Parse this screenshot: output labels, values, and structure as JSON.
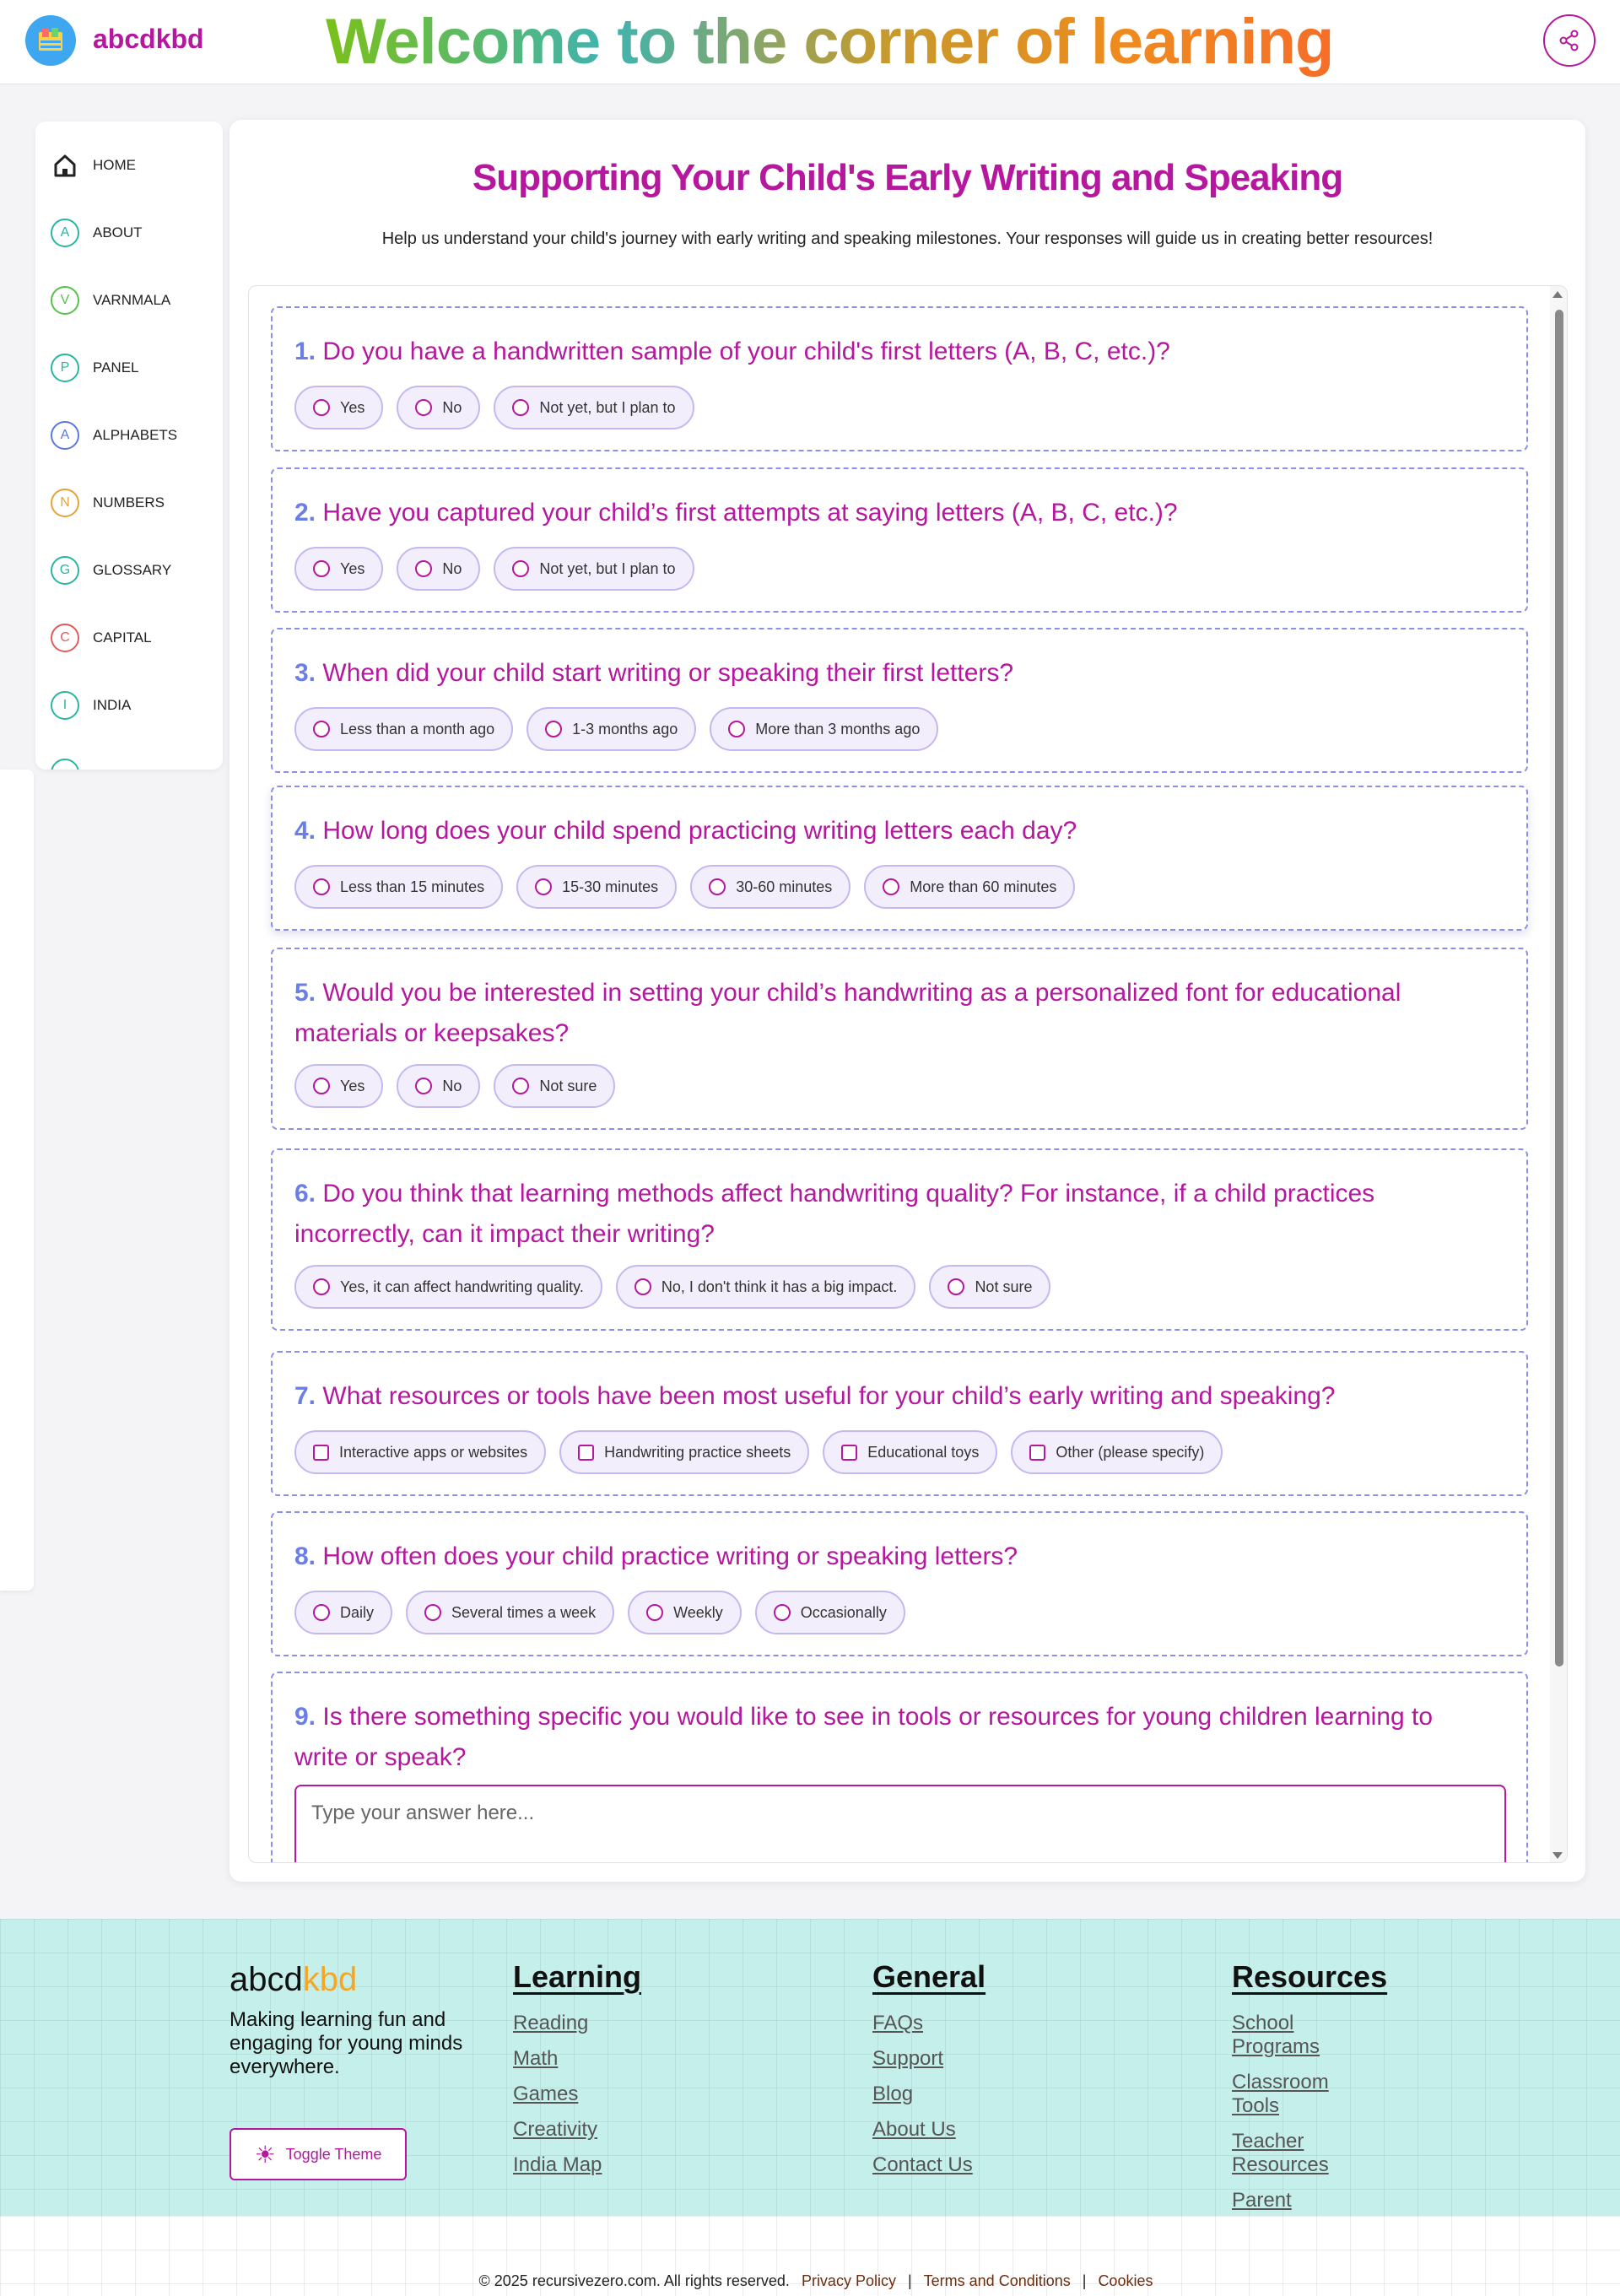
{
  "header": {
    "brand": "abcdkbd",
    "welcome": "Welcome to the corner of learning"
  },
  "sidebar": {
    "items": [
      {
        "label": "HOME",
        "icon": "home-icon",
        "letter": "",
        "color": "#222222"
      },
      {
        "label": "ABOUT",
        "icon": "letter-a-icon",
        "letter": "A",
        "color": "#2bb5a0"
      },
      {
        "label": "VARNMALA",
        "icon": "letter-v-icon",
        "letter": "V",
        "color": "#55c24a"
      },
      {
        "label": "PANEL",
        "icon": "letter-p-icon",
        "letter": "P",
        "color": "#2bb5a0"
      },
      {
        "label": "ALPHABETS",
        "icon": "letter-a-icon",
        "letter": "A",
        "color": "#5d77e0"
      },
      {
        "label": "NUMBERS",
        "icon": "letter-n-icon",
        "letter": "N",
        "color": "#e6a23a"
      },
      {
        "label": "GLOSSARY",
        "icon": "letter-g-icon",
        "letter": "G",
        "color": "#2bb5a0"
      },
      {
        "label": "CAPITAL",
        "icon": "letter-c-icon",
        "letter": "C",
        "color": "#e25b5b"
      },
      {
        "label": "INDIA",
        "icon": "letter-i-icon",
        "letter": "I",
        "color": "#2bb5a0"
      }
    ]
  },
  "main": {
    "title": "Supporting Your Child's Early Writing and Speaking",
    "subtitle": "Help us understand your child's journey with early writing and speaking milestones. Your responses will guide us in creating better resources!"
  },
  "questions": [
    {
      "num": "1.",
      "text": "Do you have a handwritten sample of your child's first letters (A, B, C, etc.)?",
      "type": "radio",
      "options": [
        "Yes",
        "No",
        "Not yet, but I plan to"
      ]
    },
    {
      "num": "2.",
      "text": "Have you captured your child’s first attempts at saying letters (A, B, C, etc.)?",
      "type": "radio",
      "options": [
        "Yes",
        "No",
        "Not yet, but I plan to"
      ]
    },
    {
      "num": "3.",
      "text": "When did your child start writing or speaking their first letters?",
      "type": "radio",
      "options": [
        "Less than a month ago",
        "1-3 months ago",
        "More than 3 months ago"
      ]
    },
    {
      "num": "4.",
      "text": "How long does your child spend practicing writing letters each day?",
      "type": "radio",
      "options": [
        "Less than 15 minutes",
        "15-30 minutes",
        "30-60 minutes",
        "More than 60 minutes"
      ]
    },
    {
      "num": "5.",
      "text": "Would you be interested in setting your child’s handwriting as a personalized font for educational materials or keepsakes?",
      "type": "radio",
      "options": [
        "Yes",
        "No",
        "Not sure"
      ]
    },
    {
      "num": "6.",
      "text": "Do you think that learning methods affect handwriting quality? For instance, if a child practices incorrectly, can it impact their writing?",
      "type": "radio",
      "options": [
        "Yes, it can affect handwriting quality.",
        "No, I don't think it has a big impact.",
        "Not sure"
      ]
    },
    {
      "num": "7.",
      "text": "What resources or tools have been most useful for your child’s early writing and speaking?",
      "type": "checkbox",
      "options": [
        "Interactive apps or websites",
        "Handwriting practice sheets",
        "Educational toys",
        "Other (please specify)"
      ]
    },
    {
      "num": "8.",
      "text": "How often does your child practice writing or speaking letters?",
      "type": "radio",
      "options": [
        "Daily",
        "Several times a week",
        "Weekly",
        "Occasionally"
      ]
    },
    {
      "num": "9.",
      "text": "Is there something specific you would like to see in tools or resources for young children learning to write or speak?",
      "type": "text",
      "placeholder": "Type your answer here..."
    }
  ],
  "footer": {
    "brand_a": "abcd",
    "brand_b": "kbd",
    "tagline": "Making learning fun and engaging for young minds everywhere.",
    "toggle_label": "Toggle Theme",
    "columns": [
      {
        "title": "Learning",
        "links": [
          "Reading",
          "Math",
          "Games",
          "Creativity",
          "India Map"
        ]
      },
      {
        "title": "General",
        "links": [
          "FAQs",
          "Support",
          "Blog",
          "About Us",
          "Contact Us"
        ]
      },
      {
        "title": "Resources",
        "links": [
          "School Programs",
          "Classroom Tools",
          "Teacher Resources",
          "Parent Resources"
        ]
      }
    ],
    "copyright": "© 2025 recursivezero.com. All rights reserved.",
    "legal_links": [
      "Privacy Policy",
      "Terms and Conditions",
      "Cookies"
    ]
  }
}
